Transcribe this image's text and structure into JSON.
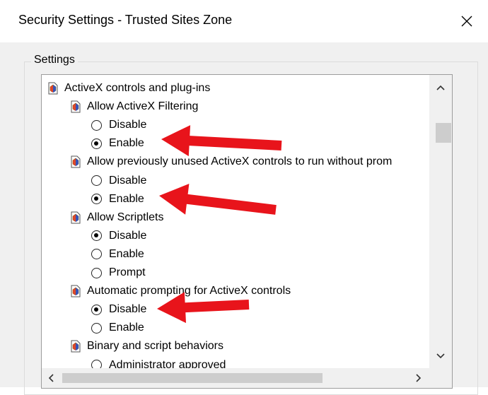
{
  "window": {
    "title": "Security Settings - Trusted Sites Zone",
    "close_icon": "close-icon"
  },
  "group": {
    "label": "Settings"
  },
  "tree": {
    "items": [
      {
        "type": "category",
        "label": "ActiveX controls and plug-ins",
        "indent": 0
      },
      {
        "type": "setting",
        "label": "Allow ActiveX Filtering",
        "indent": 1
      },
      {
        "type": "option",
        "label": "Disable",
        "checked": false,
        "indent": 2
      },
      {
        "type": "option",
        "label": "Enable",
        "checked": true,
        "indent": 2
      },
      {
        "type": "setting",
        "label": "Allow previously unused ActiveX controls to run without prom",
        "indent": 1
      },
      {
        "type": "option",
        "label": "Disable",
        "checked": false,
        "indent": 2
      },
      {
        "type": "option",
        "label": "Enable",
        "checked": true,
        "indent": 2
      },
      {
        "type": "setting",
        "label": "Allow Scriptlets",
        "indent": 1
      },
      {
        "type": "option",
        "label": "Disable",
        "checked": true,
        "indent": 2
      },
      {
        "type": "option",
        "label": "Enable",
        "checked": false,
        "indent": 2
      },
      {
        "type": "option",
        "label": "Prompt",
        "checked": false,
        "indent": 2
      },
      {
        "type": "setting",
        "label": "Automatic prompting for ActiveX controls",
        "indent": 1
      },
      {
        "type": "option",
        "label": "Disable",
        "checked": true,
        "indent": 2
      },
      {
        "type": "option",
        "label": "Enable",
        "checked": false,
        "indent": 2
      },
      {
        "type": "setting",
        "label": "Binary and script behaviors",
        "indent": 1
      },
      {
        "type": "option",
        "label": "Administrator approved",
        "checked": false,
        "indent": 2
      }
    ]
  },
  "annotations": {
    "color": "#e8141b",
    "arrow_targets": [
      "Enable",
      "Enable",
      "Disable"
    ]
  }
}
